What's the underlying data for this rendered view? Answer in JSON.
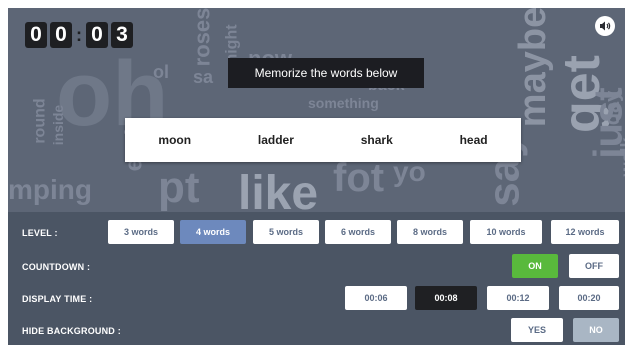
{
  "timer": {
    "d1": "0",
    "d2": "0",
    "colon": ":",
    "d3": "0",
    "d4": "3"
  },
  "instruction": "Memorize the words below",
  "words": [
    "moon",
    "ladder",
    "shark",
    "head"
  ],
  "settings": {
    "level": {
      "label": "LEVEL :",
      "options": [
        "3 words",
        "4 words",
        "5 words",
        "6 words",
        "8 words",
        "10 words",
        "12 words"
      ],
      "selected": "4 words"
    },
    "countdown": {
      "label": "COUNTDOWN :",
      "on": "ON",
      "off": "OFF",
      "selected": "ON"
    },
    "display_time": {
      "label": "DISPLAY TIME :",
      "options": [
        "00:06",
        "00:08",
        "00:12",
        "00:20"
      ],
      "selected": "00:08"
    },
    "hide_background": {
      "label": "HIDE BACKGROUND :",
      "yes": "YES",
      "no": "NO",
      "selected": "NO"
    }
  },
  "colors": {
    "hero_bg": "#5d6676",
    "panel_bg": "#4b5564",
    "selected_level": "#6d89bd",
    "selected_time": "#1f2023",
    "on_green": "#59b93c",
    "no_grey": "#a9b6c4"
  },
  "icons": {
    "sound": "speaker-icon"
  }
}
